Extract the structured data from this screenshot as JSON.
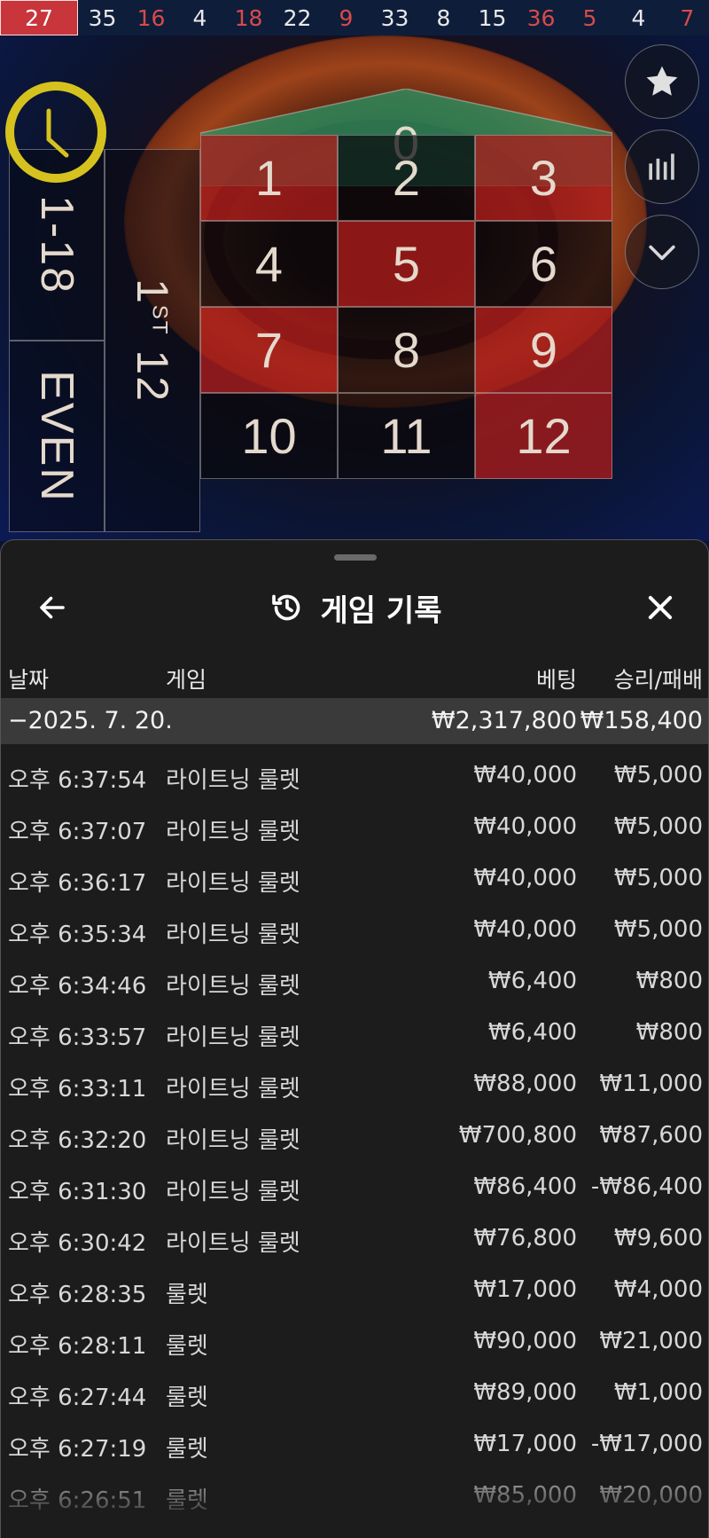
{
  "history_strip": [
    {
      "n": "27",
      "c": "red"
    },
    {
      "n": "35",
      "c": "black"
    },
    {
      "n": "16",
      "c": "red"
    },
    {
      "n": "4",
      "c": "black"
    },
    {
      "n": "18",
      "c": "red"
    },
    {
      "n": "22",
      "c": "black"
    },
    {
      "n": "9",
      "c": "red"
    },
    {
      "n": "33",
      "c": "black"
    },
    {
      "n": "8",
      "c": "black"
    },
    {
      "n": "15",
      "c": "black"
    },
    {
      "n": "36",
      "c": "red"
    },
    {
      "n": "5",
      "c": "red"
    },
    {
      "n": "4",
      "c": "black"
    },
    {
      "n": "7",
      "c": "red"
    }
  ],
  "table": {
    "zero": "0",
    "numbers": [
      {
        "n": "1",
        "c": "r"
      },
      {
        "n": "2",
        "c": "b"
      },
      {
        "n": "3",
        "c": "r"
      },
      {
        "n": "4",
        "c": "b"
      },
      {
        "n": "5",
        "c": "r"
      },
      {
        "n": "6",
        "c": "b"
      },
      {
        "n": "7",
        "c": "r"
      },
      {
        "n": "8",
        "c": "b"
      },
      {
        "n": "9",
        "c": "r"
      },
      {
        "n": "10",
        "c": "b"
      },
      {
        "n": "11",
        "c": "b"
      },
      {
        "n": "12",
        "c": "r"
      }
    ],
    "low_label": "1-18",
    "even_label": "EVEN",
    "dozen_label": "1",
    "dozen_suffix": "ST",
    "dozen_num": "12"
  },
  "sheet": {
    "title": "게임 기록",
    "columns": {
      "date": "날짜",
      "game": "게임",
      "bet": "베팅",
      "win": "승리/패배"
    },
    "group": {
      "date": "−2025. 7. 20.",
      "bet": "₩2,317,800",
      "win": "₩158,400"
    },
    "rows": [
      {
        "time": "오후 6:37:54",
        "game": "라이트닝 룰렛",
        "bet": "₩40,000",
        "win": "₩5,000"
      },
      {
        "time": "오후 6:37:07",
        "game": "라이트닝 룰렛",
        "bet": "₩40,000",
        "win": "₩5,000"
      },
      {
        "time": "오후 6:36:17",
        "game": "라이트닝 룰렛",
        "bet": "₩40,000",
        "win": "₩5,000"
      },
      {
        "time": "오후 6:35:34",
        "game": "라이트닝 룰렛",
        "bet": "₩40,000",
        "win": "₩5,000"
      },
      {
        "time": "오후 6:34:46",
        "game": "라이트닝 룰렛",
        "bet": "₩6,400",
        "win": "₩800"
      },
      {
        "time": "오후 6:33:57",
        "game": "라이트닝 룰렛",
        "bet": "₩6,400",
        "win": "₩800"
      },
      {
        "time": "오후 6:33:11",
        "game": "라이트닝 룰렛",
        "bet": "₩88,000",
        "win": "₩11,000"
      },
      {
        "time": "오후 6:32:20",
        "game": "라이트닝 룰렛",
        "bet": "₩700,800",
        "win": "₩87,600"
      },
      {
        "time": "오후 6:31:30",
        "game": "라이트닝 룰렛",
        "bet": "₩86,400",
        "win": "-₩86,400"
      },
      {
        "time": "오후 6:30:42",
        "game": "라이트닝 룰렛",
        "bet": "₩76,800",
        "win": "₩9,600"
      },
      {
        "time": "오후 6:28:35",
        "game": "룰렛",
        "bet": "₩17,000",
        "win": "₩4,000"
      },
      {
        "time": "오후 6:28:11",
        "game": "룰렛",
        "bet": "₩90,000",
        "win": "₩21,000"
      },
      {
        "time": "오후 6:27:44",
        "game": "룰렛",
        "bet": "₩89,000",
        "win": "₩1,000"
      },
      {
        "time": "오후 6:27:19",
        "game": "룰렛",
        "bet": "₩17,000",
        "win": "-₩17,000"
      },
      {
        "time": "오후 6:26:51",
        "game": "룰렛",
        "bet": "₩85,000",
        "win": "₩20,000"
      }
    ]
  }
}
